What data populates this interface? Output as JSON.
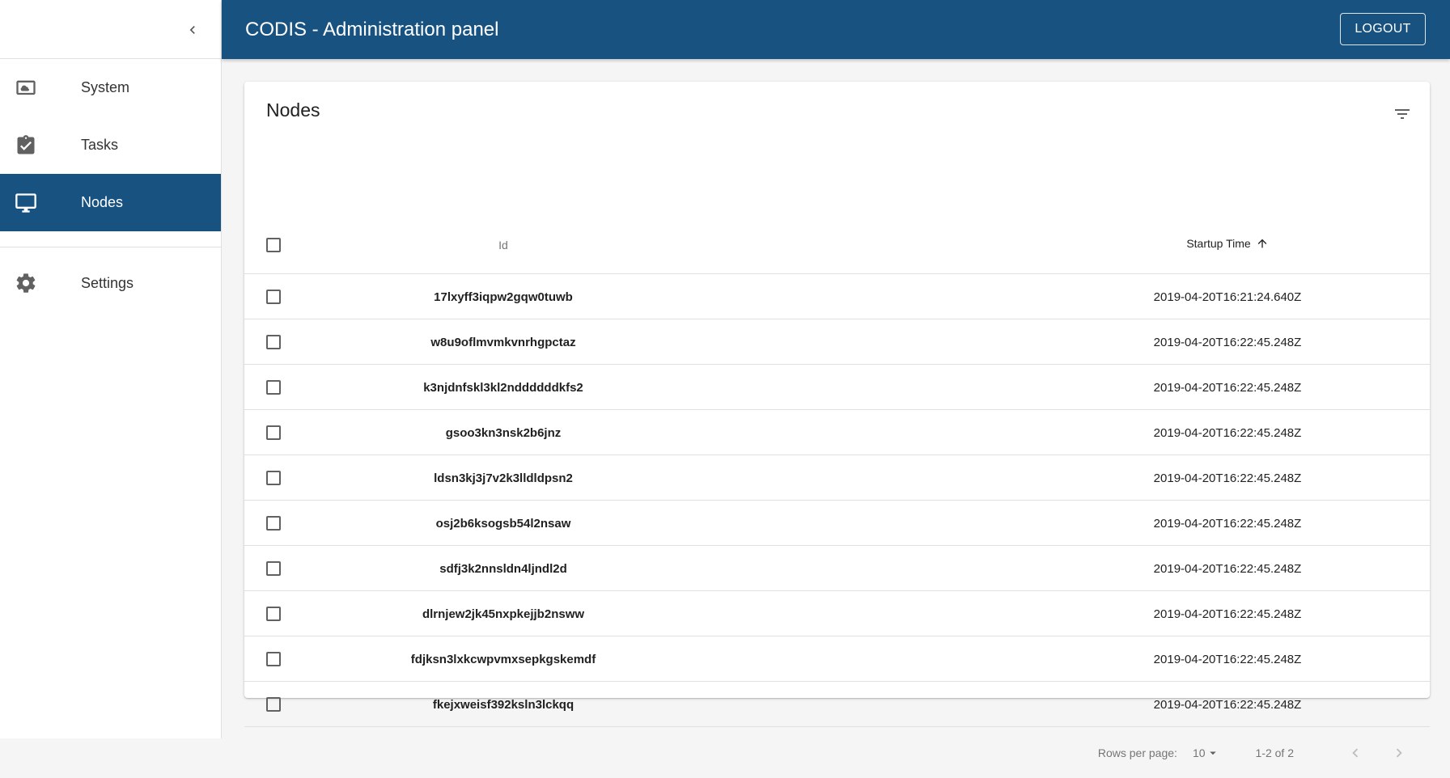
{
  "app": {
    "title": "CODIS - Administration panel",
    "logout_label": "LOGOUT"
  },
  "sidebar": {
    "items": [
      {
        "label": "System",
        "icon": "cloud-computer-icon",
        "active": false
      },
      {
        "label": "Tasks",
        "icon": "clipboard-check-icon",
        "active": false
      },
      {
        "label": "Nodes",
        "icon": "monitor-icon",
        "active": true
      },
      {
        "label": "Settings",
        "icon": "gear-icon",
        "active": false
      }
    ]
  },
  "card": {
    "title": "Nodes",
    "columns": {
      "id": "Id",
      "startup_time": "Startup Time"
    },
    "rows": [
      {
        "id": "17lxyff3iqpw2gqw0tuwb",
        "startup_time": "2019-04-20T16:21:24.640Z"
      },
      {
        "id": "w8u9oflmvmkvnrhgpctaz",
        "startup_time": "2019-04-20T16:22:45.248Z"
      },
      {
        "id": "k3njdnfskl3kl2nddddddkfs2",
        "startup_time": "2019-04-20T16:22:45.248Z"
      },
      {
        "id": "gsoo3kn3nsk2b6jnz",
        "startup_time": "2019-04-20T16:22:45.248Z"
      },
      {
        "id": "ldsn3kj3j7v2k3lldldpsn2",
        "startup_time": "2019-04-20T16:22:45.248Z"
      },
      {
        "id": "osj2b6ksogsb54l2nsaw",
        "startup_time": "2019-04-20T16:22:45.248Z"
      },
      {
        "id": "sdfj3k2nnsldn4ljndl2d",
        "startup_time": "2019-04-20T16:22:45.248Z"
      },
      {
        "id": "dlrnjew2jk45nxpkejjb2nsww",
        "startup_time": "2019-04-20T16:22:45.248Z"
      },
      {
        "id": "fdjksn3lxkcwpvmxsepkgskemdf",
        "startup_time": "2019-04-20T16:22:45.248Z"
      },
      {
        "id": "fkejxweisf392ksln3lckqq",
        "startup_time": "2019-04-20T16:22:45.248Z"
      }
    ],
    "pagination": {
      "rows_per_page_label": "Rows per page:",
      "rows_per_page_value": "10",
      "range_label": "1-2 of 2"
    }
  },
  "colors": {
    "primary": "#175281",
    "background": "#f5f5f5"
  }
}
